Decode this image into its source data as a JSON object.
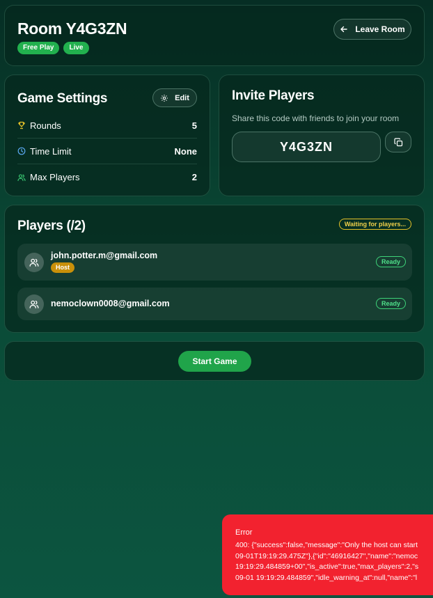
{
  "header": {
    "room_title": "Room Y4G3ZN",
    "badges": [
      "Free Play",
      "Live"
    ],
    "leave_label": "Leave Room"
  },
  "settings": {
    "title": "Game Settings",
    "edit_label": "Edit",
    "rows": [
      {
        "label": "Rounds",
        "value": "5",
        "icon": "trophy-icon"
      },
      {
        "label": "Time Limit",
        "value": "None",
        "icon": "clock-icon"
      },
      {
        "label": "Max Players",
        "value": "2",
        "icon": "users-icon"
      }
    ]
  },
  "invite": {
    "title": "Invite Players",
    "subtitle": "Share this code with friends to join your room",
    "code": "Y4G3ZN",
    "copy_icon": "copy-icon"
  },
  "players": {
    "title": "Players (/2)",
    "status": "Waiting for players...",
    "list": [
      {
        "email": "john.potter.m@gmail.com",
        "role": "Host",
        "status": "Ready"
      },
      {
        "email": "nemoclown0008@gmail.com",
        "role": "",
        "status": "Ready"
      }
    ]
  },
  "actions": {
    "start_label": "Start Game"
  },
  "error": {
    "title": "Error",
    "message": "400: {\"success\":false,\"message\":\"Only the host can start\n09-01T19:19:29.475Z\"},{\"id\":\"46916427\",\"name\":\"nemoc\n19:19:29.484859+00\",\"is_active\":true,\"max_players\":2,\"s\n09-01 19:19:29.484859\",\"idle_warning_at\":null,\"name\":\"l"
  },
  "colors": {
    "accent_green": "#20a44a",
    "warning_yellow": "#e6c229",
    "host_amber": "#c9900a",
    "error_red": "#f2222f"
  }
}
